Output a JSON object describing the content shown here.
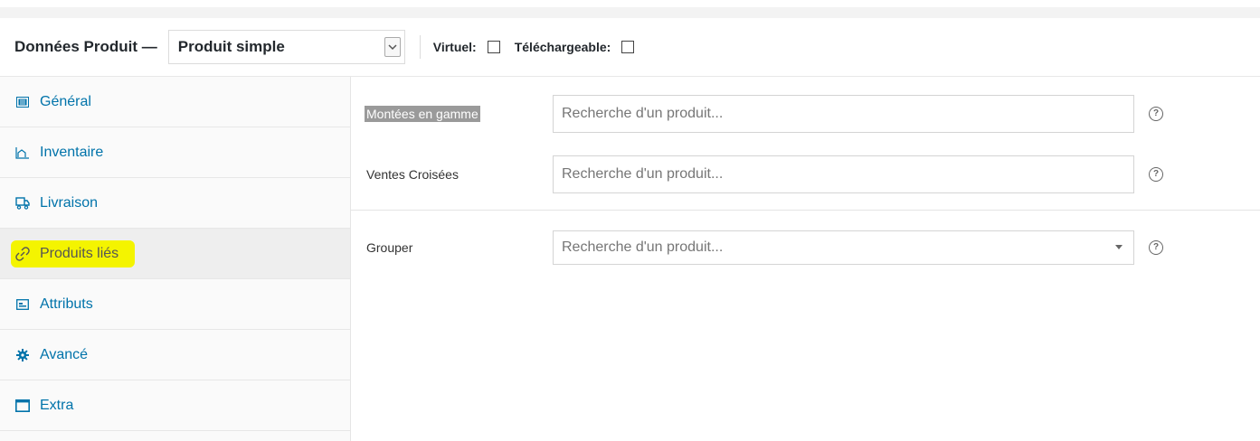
{
  "header": {
    "title": "Données Produit —",
    "product_type": "Produit simple",
    "virtual_label": "Virtuel:",
    "virtual_checked": false,
    "downloadable_label": "Téléchargeable:",
    "downloadable_checked": false
  },
  "sidebar": {
    "items": [
      {
        "label": "Général",
        "icon": "general-icon",
        "active": false
      },
      {
        "label": "Inventaire",
        "icon": "inventory-icon",
        "active": false
      },
      {
        "label": "Livraison",
        "icon": "truck-icon",
        "active": false
      },
      {
        "label": "Produits liés",
        "icon": "link-icon",
        "active": true,
        "highlighted": true
      },
      {
        "label": "Attributs",
        "icon": "attributes-icon",
        "active": false
      },
      {
        "label": "Avancé",
        "icon": "gear-icon",
        "active": false
      },
      {
        "label": "Extra",
        "icon": "window-icon",
        "active": false
      }
    ]
  },
  "main": {
    "upsells": {
      "label": "Montées en gamme",
      "placeholder": "Recherche d'un produit..."
    },
    "crosssells": {
      "label": "Ventes Croisées",
      "placeholder": "Recherche d'un produit..."
    },
    "grouped": {
      "label": "Grouper",
      "placeholder": "Recherche d'un produit..."
    },
    "help_glyph": "?"
  },
  "colors": {
    "link": "#0073aa",
    "highlight": "#f4f400",
    "active_tab_bg": "#eeeeee"
  }
}
